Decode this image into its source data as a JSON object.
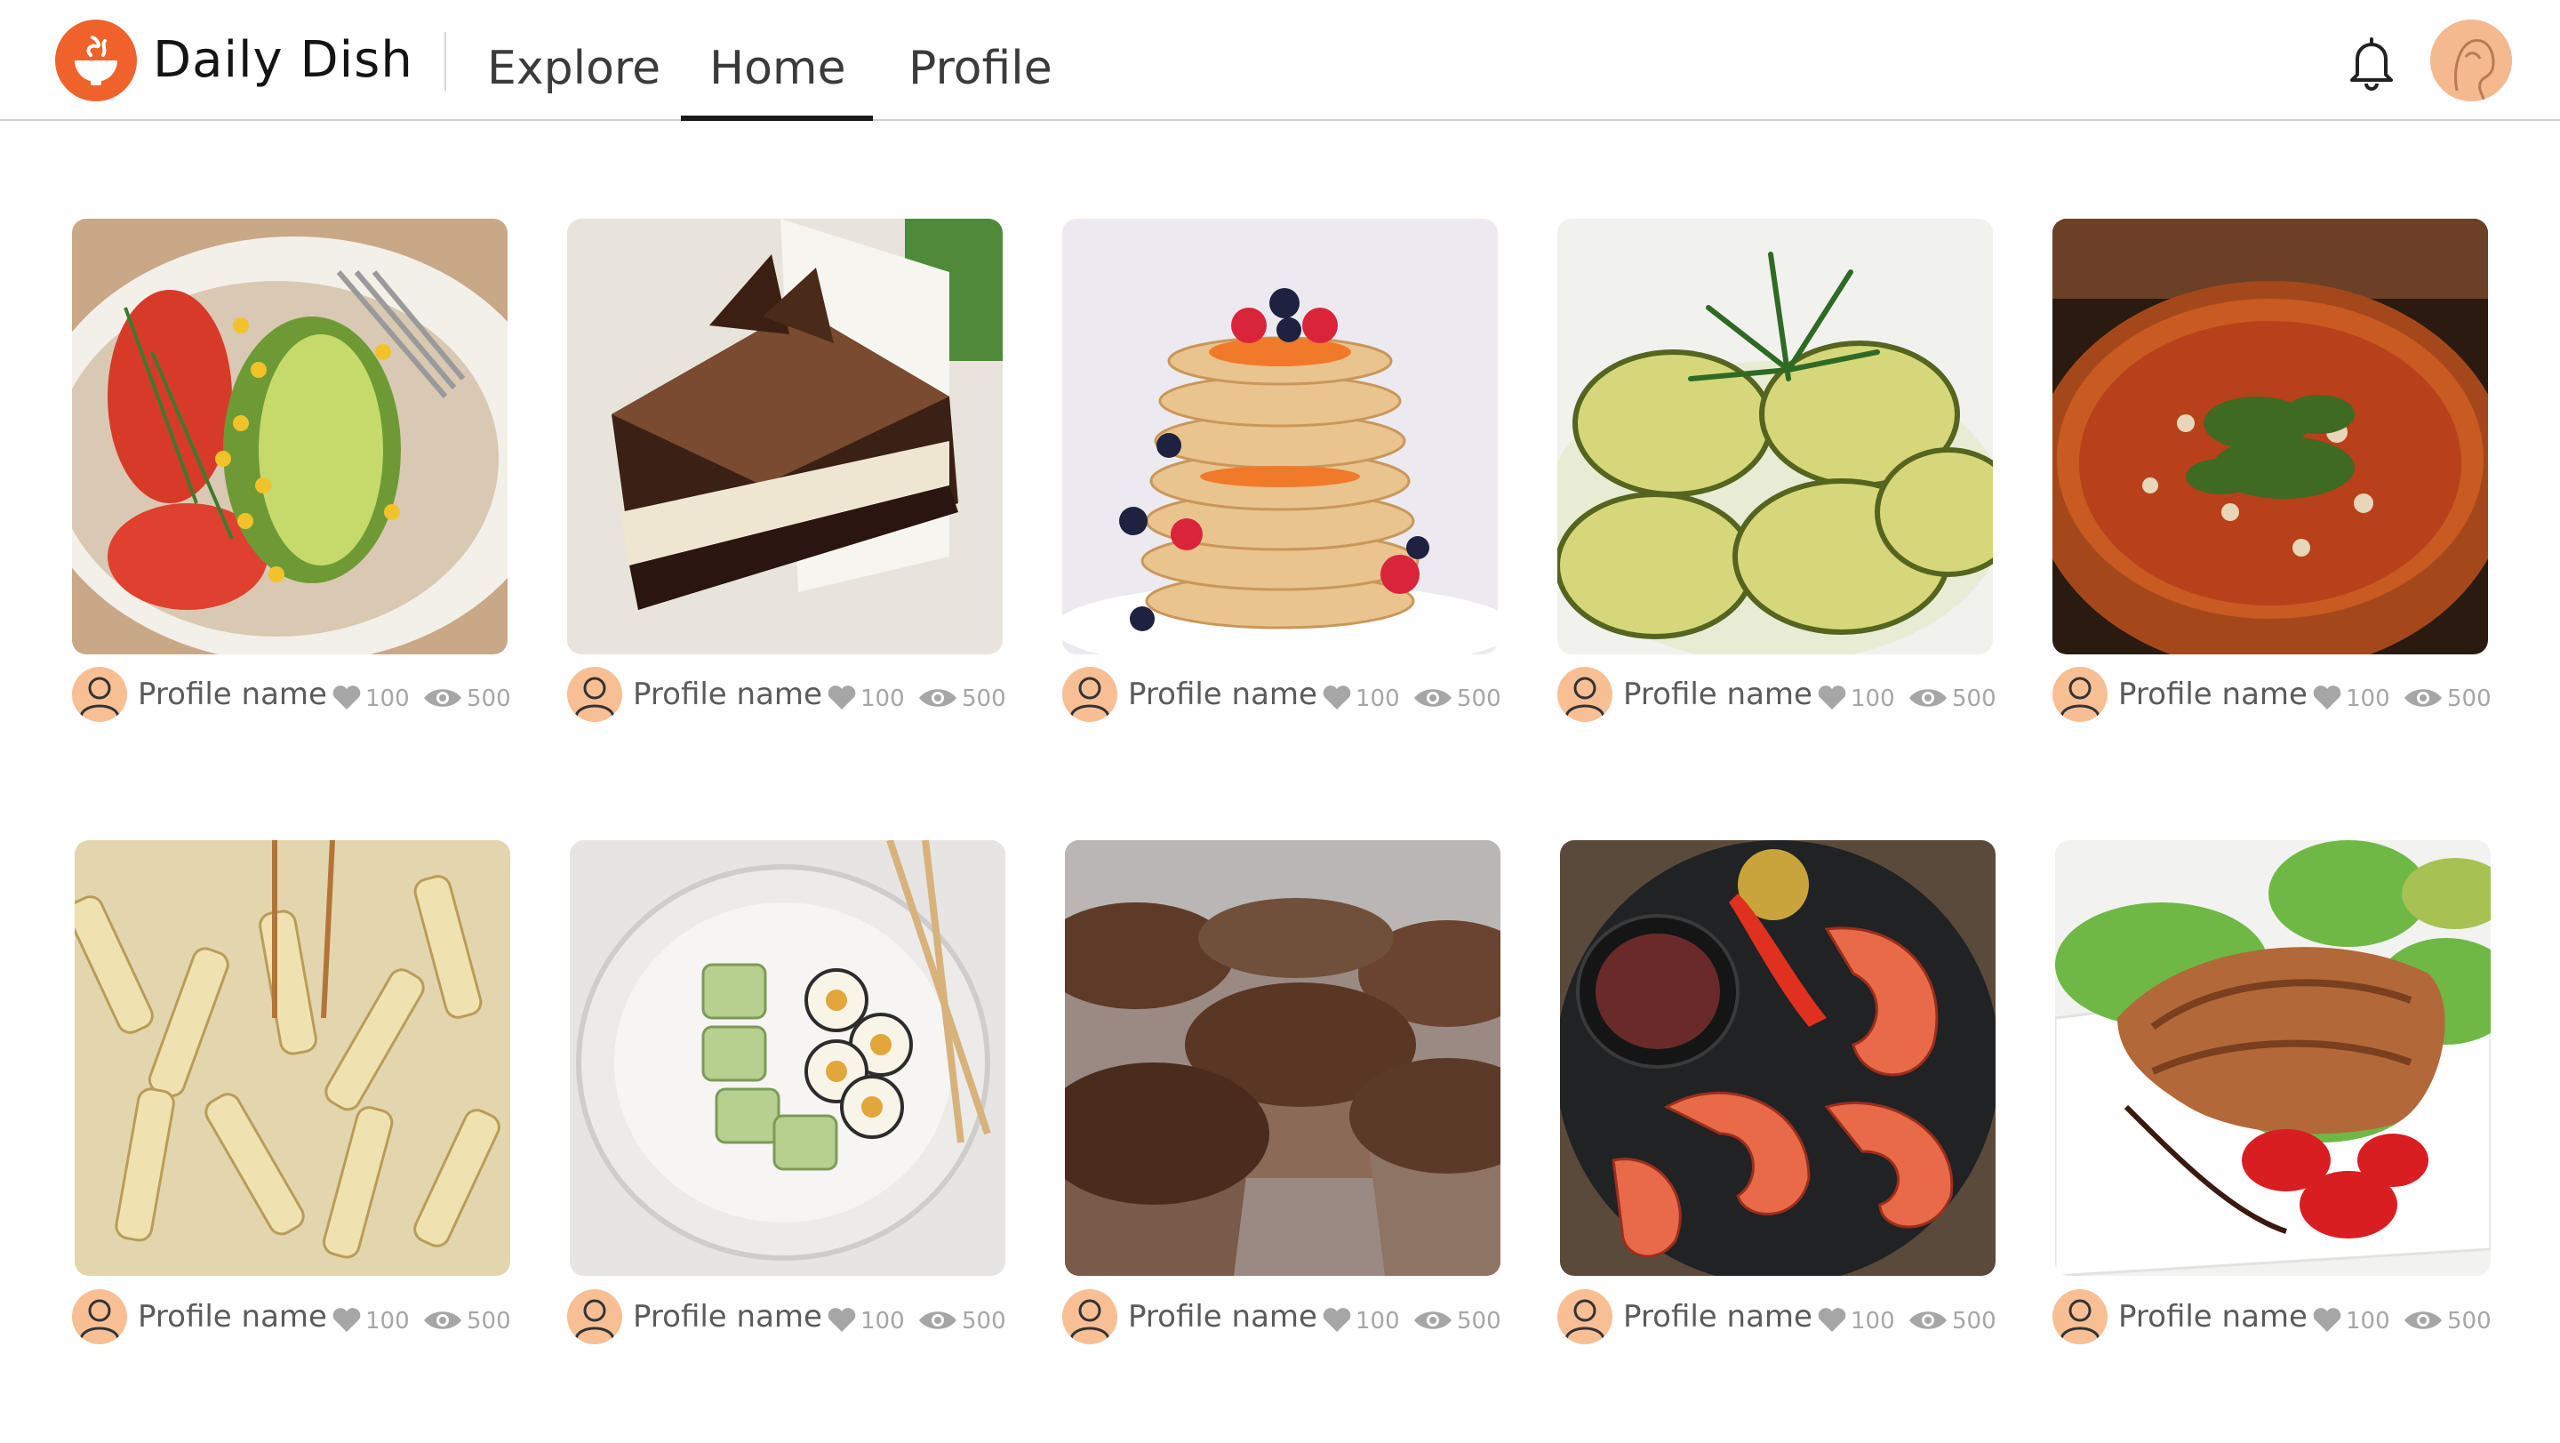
{
  "header": {
    "brand": "Daily Dish",
    "logo_icon": "bowl-icon",
    "nav": [
      {
        "label": "Explore",
        "active": false
      },
      {
        "label": "Home",
        "active": true
      },
      {
        "label": "Profile",
        "active": false
      }
    ],
    "notification_icon": "bell-icon",
    "accent_color": "#f0622b"
  },
  "feed": {
    "posts": [
      {
        "dish": "avocado-tomato-corn",
        "profile_name": "Profile name",
        "likes": "100",
        "views": "500"
      },
      {
        "dish": "chocolate-mousse-cake",
        "profile_name": "Profile name",
        "likes": "100",
        "views": "500"
      },
      {
        "dish": "pancake-stack",
        "profile_name": "Profile name",
        "likes": "100",
        "views": "500"
      },
      {
        "dish": "zucchini-rolls",
        "profile_name": "Profile name",
        "likes": "100",
        "views": "500"
      },
      {
        "dish": "soup-bowl",
        "profile_name": "Profile name",
        "likes": "100",
        "views": "500"
      },
      {
        "dish": "creamy-penne",
        "profile_name": "Profile name",
        "likes": "100",
        "views": "500"
      },
      {
        "dish": "sushi-plate",
        "profile_name": "Profile name",
        "likes": "100",
        "views": "500"
      },
      {
        "dish": "chocolate-muffins",
        "profile_name": "Profile name",
        "likes": "100",
        "views": "500"
      },
      {
        "dish": "grilled-shrimp",
        "profile_name": "Profile name",
        "likes": "100",
        "views": "500"
      },
      {
        "dish": "grilled-salmon",
        "profile_name": "Profile name",
        "likes": "100",
        "views": "500"
      }
    ]
  }
}
